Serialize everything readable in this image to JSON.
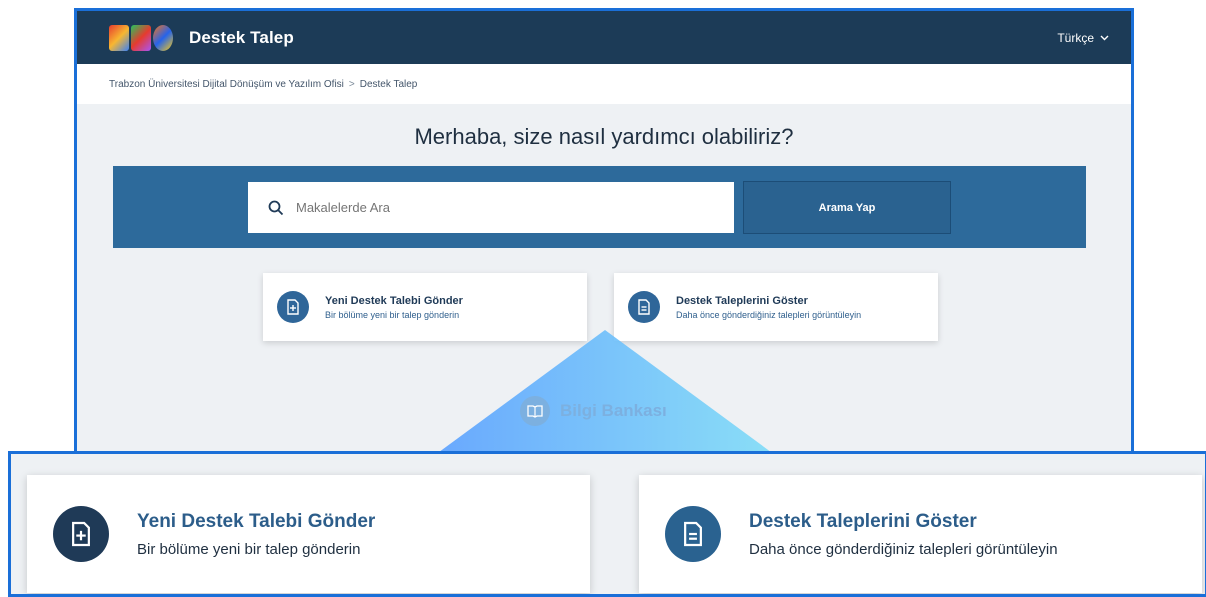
{
  "header": {
    "app_title": "Destek Talep",
    "language": "Türkçe"
  },
  "breadcrumb": {
    "items": [
      "Trabzon Üniversitesi Dijital Dönüşüm ve Yazılım Ofisi",
      "Destek Talep"
    ],
    "separator": ">"
  },
  "hero": {
    "title": "Merhaba, size nasıl yardımcı olabiliriz?"
  },
  "search": {
    "placeholder": "Makalelerde Ara",
    "button_label": "Arama Yap"
  },
  "cards": [
    {
      "title": "Yeni Destek Talebi Gönder",
      "subtitle": "Bir bölüme yeni bir talep gönderin",
      "icon": "file-plus-icon"
    },
    {
      "title": "Destek Taleplerini Göster",
      "subtitle": "Daha önce gönderdiğiniz talepleri görüntüleyin",
      "icon": "file-text-icon"
    }
  ],
  "knowledge_base": {
    "label": "Bilgi Bankası",
    "icon": "book-icon"
  },
  "colors": {
    "header_bg": "#1c3b57",
    "search_band": "#2d6a9b",
    "accent": "#2f6699",
    "highlight_border": "#1a6fd8"
  }
}
